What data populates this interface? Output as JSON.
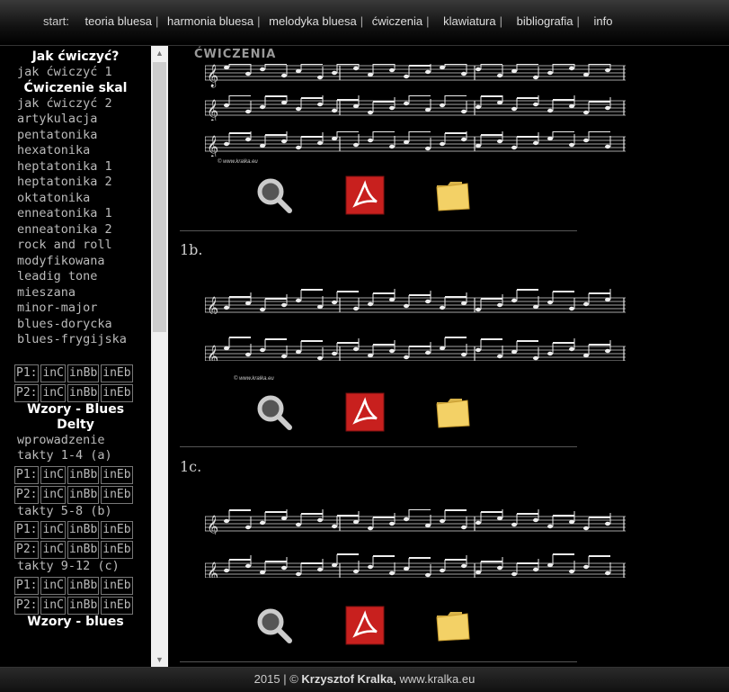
{
  "nav": {
    "start_label": "start:",
    "items": [
      "teoria bluesa",
      "harmonia bluesa",
      "melodyka bluesa",
      "ćwiczenia",
      "klawiatura",
      "bibliografia",
      "info"
    ],
    "separator": "|"
  },
  "sidebar": {
    "heading1": "Jak ćwiczyć?",
    "item_jak1": "jak ćwiczyć 1",
    "heading2": "Ćwiczenie skal",
    "scales": [
      "jak ćwiczyć 2",
      "artykulacja",
      "pentatonika",
      "hexatonika",
      "heptatonika 1",
      "heptatonika 2",
      "oktatonika",
      "enneatonika 1",
      "enneatonika 2",
      "rock and roll",
      "modyfikowana",
      "leadig tone",
      "mieszana",
      "minor-major",
      "blues-dorycka",
      "blues-frygijska"
    ],
    "rows": {
      "p1": [
        "P1:",
        "inC",
        "inBb",
        "inEb"
      ],
      "p2": [
        "P2:",
        "inC",
        "inBb",
        "inEb"
      ]
    },
    "heading3": "Wzory - Blues Delty",
    "item_wprow": "wprowadzenie",
    "takty1": "takty 1-4 (a)",
    "takty2": "takty 5-8 (b)",
    "takty3": "takty 9-12 (c)",
    "heading4": "Wzory - blues"
  },
  "main": {
    "title": "ĆWICZENIA",
    "ex_1b": "1b.",
    "ex_1c": "1c.",
    "copyright": "© www.kralka.eu"
  },
  "footer": {
    "year": "2015 | ©",
    "author": "Krzysztof Kralka,",
    "site": "www.kralka.eu"
  },
  "colors": {
    "pdf_red": "#c8201e",
    "folder_yellow": "#f3d166"
  },
  "icons": [
    "magnifier-icon",
    "pdf-icon",
    "folder-icon"
  ]
}
